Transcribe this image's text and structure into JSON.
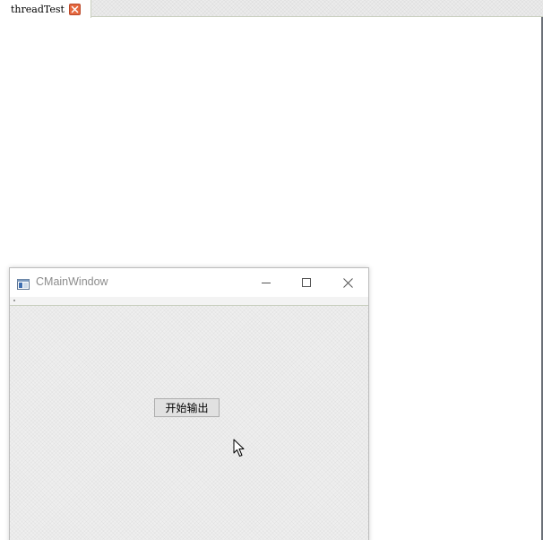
{
  "editor": {
    "tab": {
      "label": "threadTest",
      "close_icon": "close-icon"
    }
  },
  "window": {
    "title": "CMainWindow",
    "icon": "app-window-icon",
    "controls": {
      "minimize_icon": "minimize-icon",
      "maximize_icon": "maximize-icon",
      "close_icon": "close-icon"
    },
    "button": {
      "label": "开始输出"
    }
  },
  "colors": {
    "tab_close_bg": "#e5683f",
    "title_text": "#8c8c8c",
    "window_bg": "#efefef",
    "button_bg": "#e1e1e1"
  }
}
